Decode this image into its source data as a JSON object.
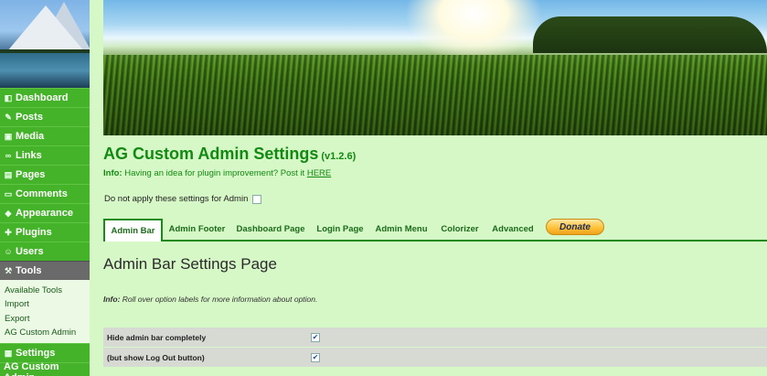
{
  "sidebar": {
    "items": [
      {
        "label": "Dashboard",
        "icon": "dashboard-icon",
        "glyph": "◧"
      },
      {
        "label": "Posts",
        "icon": "pin-icon",
        "glyph": "✎"
      },
      {
        "label": "Media",
        "icon": "media-icon",
        "glyph": "▣"
      },
      {
        "label": "Links",
        "icon": "link-icon",
        "glyph": "∞"
      },
      {
        "label": "Pages",
        "icon": "pages-icon",
        "glyph": "▤"
      },
      {
        "label": "Comments",
        "icon": "comment-icon",
        "glyph": "▭"
      },
      {
        "label": "Appearance",
        "icon": "appearance-icon",
        "glyph": "◆"
      },
      {
        "label": "Plugins",
        "icon": "plugin-icon",
        "glyph": "✚"
      },
      {
        "label": "Users",
        "icon": "users-icon",
        "glyph": "☺"
      }
    ],
    "active": {
      "label": "Tools",
      "icon": "tools-icon",
      "glyph": "⚒"
    },
    "submenu": [
      "Available Tools",
      "Import",
      "Export",
      "AG Custom Admin"
    ],
    "bottom": [
      {
        "label": "Settings",
        "icon": "settings-icon",
        "glyph": "▦"
      },
      {
        "label": "AG Custom Admin"
      }
    ]
  },
  "header": {
    "title": "AG Custom Admin Settings",
    "version": "(v1.2.6)",
    "info_label": "Info:",
    "info_text": "Having an idea for plugin improvement? Post it",
    "info_link": "HERE",
    "noapply_label": "Do not apply these settings for Admin",
    "noapply_checked": false
  },
  "tabs": [
    "Admin Bar",
    "Admin Footer",
    "Dashboard Page",
    "Login Page",
    "Admin Menu",
    "Colorizer",
    "Advanced"
  ],
  "active_tab": "Admin Bar",
  "donate_label": "Donate",
  "section": {
    "title": "Admin Bar Settings Page",
    "info_label": "Info:",
    "info_text": "Roll over option labels for more information about option.",
    "options": [
      {
        "label": "Hide admin bar completely",
        "checked": true
      },
      {
        "label": "(but show Log Out button)",
        "checked": true
      }
    ]
  },
  "colors": {
    "sidebar_green": "#45b32a",
    "accent_green": "#128a12",
    "page_bg": "#d6f7c6"
  }
}
